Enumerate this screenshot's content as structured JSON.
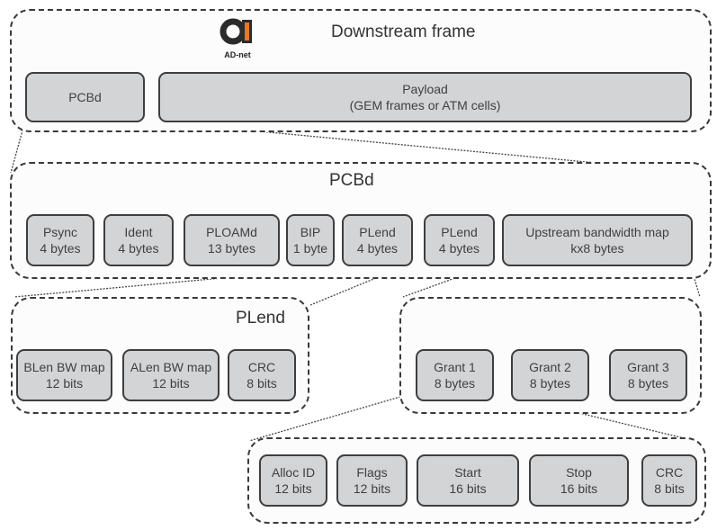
{
  "logo": {
    "text": "AD-net",
    "accent_color": "#e87722"
  },
  "downstream_frame": {
    "title": "Downstream frame",
    "fields": [
      {
        "line1": "PCBd",
        "line2": ""
      },
      {
        "line1": "Payload",
        "line2": "(GEM frames or ATM cells)"
      }
    ]
  },
  "pcbd": {
    "title": "PCBd",
    "fields": [
      {
        "line1": "Psync",
        "line2": "4 bytes"
      },
      {
        "line1": "Ident",
        "line2": "4 bytes"
      },
      {
        "line1": "PLOAMd",
        "line2": "13 bytes"
      },
      {
        "line1": "BIP",
        "line2": "1 byte"
      },
      {
        "line1": "PLend",
        "line2": "4 bytes"
      },
      {
        "line1": "PLend",
        "line2": "4 bytes"
      },
      {
        "line1": "Upstream bandwidth map",
        "line2": "kx8 bytes"
      }
    ]
  },
  "plend": {
    "title": "PLend",
    "fields": [
      {
        "line1": "BLen BW map",
        "line2": "12 bits"
      },
      {
        "line1": "ALen BW map",
        "line2": "12 bits"
      },
      {
        "line1": "CRC",
        "line2": "8 bits"
      }
    ]
  },
  "bw_map": {
    "fields": [
      {
        "line1": "Grant 1",
        "line2": "8 bytes"
      },
      {
        "line1": "Grant 2",
        "line2": "8 bytes"
      },
      {
        "line1": "Grant 3",
        "line2": "8 bytes"
      }
    ]
  },
  "grant": {
    "fields": [
      {
        "line1": "Alloc ID",
        "line2": "12 bits"
      },
      {
        "line1": "Flags",
        "line2": "12 bits"
      },
      {
        "line1": "Start",
        "line2": "16 bits"
      },
      {
        "line1": "Stop",
        "line2": "16 bits"
      },
      {
        "line1": "CRC",
        "line2": "8 bits"
      }
    ]
  }
}
